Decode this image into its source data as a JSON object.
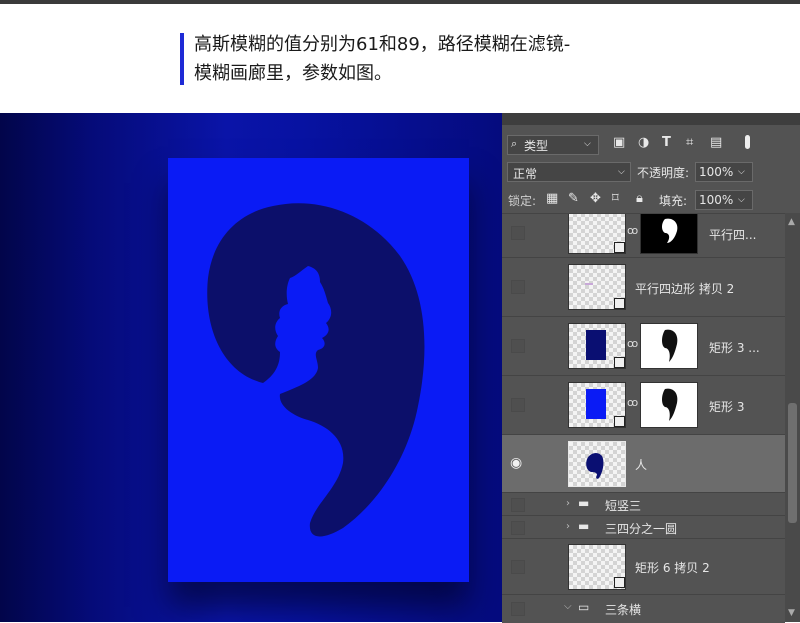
{
  "note": {
    "line1": "高斯模糊的值分别为61和89，路径模糊在滤镜-",
    "line2": "模糊画廊里，参数如图。"
  },
  "panel": {
    "filter_label": "类型",
    "blend_mode": "正常",
    "opacity_label": "不透明度:",
    "opacity_value": "100%",
    "lock_label": "锁定:",
    "fill_label": "填充:",
    "fill_value": "100%"
  },
  "layers": [
    {
      "name": "平行四...",
      "visible": false
    },
    {
      "name": "平行四边形 拷贝 2",
      "visible": false
    },
    {
      "name": "矩形 3 ...",
      "visible": false
    },
    {
      "name": "矩形 3",
      "visible": false
    },
    {
      "name": "人",
      "visible": true,
      "selected": true
    },
    {
      "name": "短竖三",
      "type": "group"
    },
    {
      "name": "三四分之一圆",
      "type": "group"
    },
    {
      "name": "矩形 6 拷贝 2",
      "visible": false
    },
    {
      "name": "三条横",
      "type": "group",
      "expanded": true
    }
  ],
  "colors": {
    "accent": "#1e2ad6",
    "artboard": "#0a1bf5",
    "silhouette": "#0c0f6a",
    "panel_bg": "#535353"
  },
  "icons": [
    "search-icon",
    "image-filter-icon",
    "adjustment-filter-icon",
    "type-filter-icon",
    "shape-filter-icon",
    "smart-object-filter-icon",
    "toggle-icon",
    "lock-pixels-icon",
    "lock-brush-icon",
    "lock-move-icon",
    "lock-artboard-icon",
    "lock-all-icon",
    "eye-icon",
    "chain-icon",
    "folder-icon",
    "chevron-right-icon",
    "chevron-down-icon"
  ]
}
